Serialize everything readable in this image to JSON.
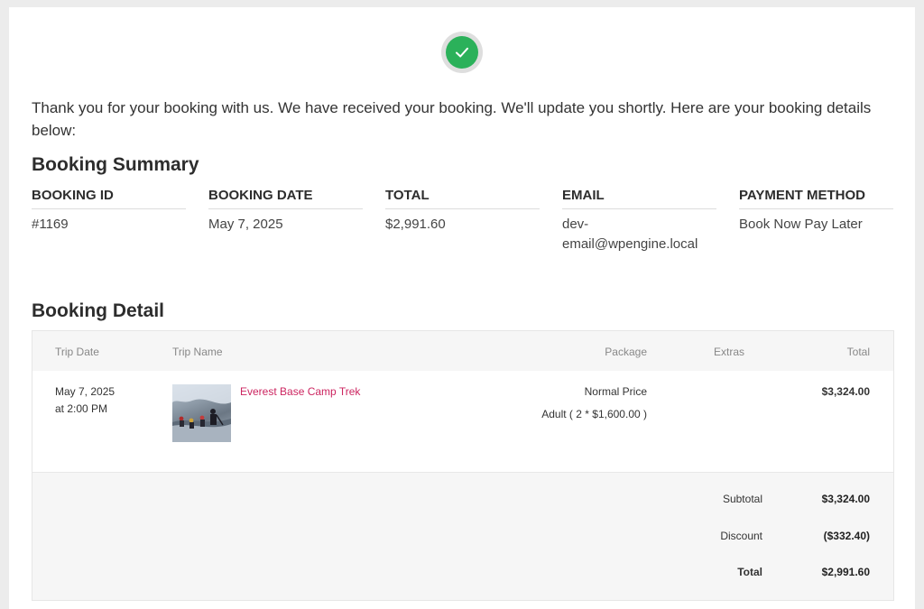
{
  "colors": {
    "success": "#2bb15a",
    "link": "#cc2560"
  },
  "confirmation_icon": "check-icon",
  "intro_text": "Thank you for your booking with us. We have received your booking. We'll update you shortly. Here are your booking details below:",
  "summary": {
    "heading": "Booking Summary",
    "booking_id": {
      "label": "BOOKING ID",
      "value": "#1169"
    },
    "booking_date": {
      "label": "BOOKING DATE",
      "value": "May 7, 2025"
    },
    "total": {
      "label": "TOTAL",
      "value": "$2,991.60"
    },
    "email": {
      "label": "EMAIL",
      "value": "dev-\nemail@wpengine.local"
    },
    "payment": {
      "label": "PAYMENT METHOD",
      "value": "Book Now Pay Later"
    }
  },
  "detail": {
    "heading": "Booking Detail",
    "columns": {
      "trip_date": "Trip Date",
      "trip_name": "Trip Name",
      "package": "Package",
      "extras": "Extras",
      "total": "Total"
    },
    "row": {
      "date": "May 7, 2025",
      "time": "at 2:00 PM",
      "trip_name": "Everest Base Camp Trek",
      "thumbnail": "trek-photo",
      "package_name": "Normal Price",
      "package_detail": "Adult ( 2 * $1,600.00 )",
      "total": "$3,324.00"
    },
    "totals": {
      "subtotal_label": "Subtotal",
      "subtotal": "$3,324.00",
      "discount_label": "Discount",
      "discount": "($332.40)",
      "total_label": "Total",
      "total": "$2,991.60"
    }
  }
}
